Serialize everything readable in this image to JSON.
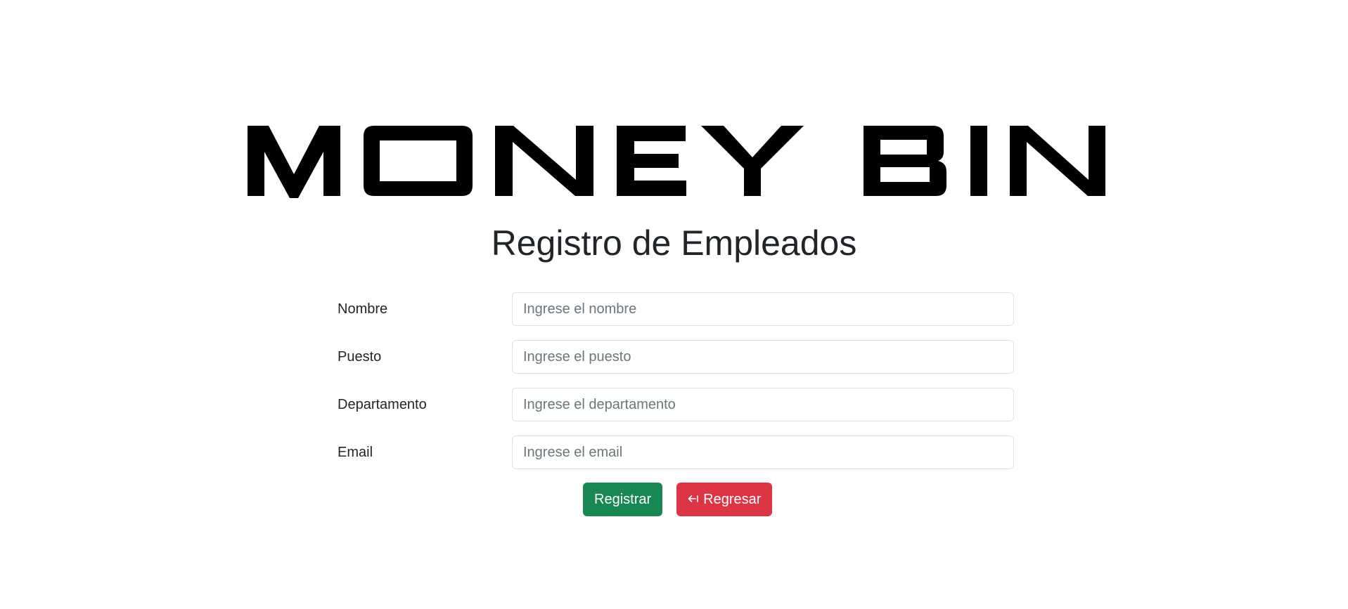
{
  "logo": {
    "text": "MONEY BIN"
  },
  "page": {
    "title": "Registro de Empleados"
  },
  "form": {
    "fields": [
      {
        "label": "Nombre",
        "placeholder": "Ingrese el nombre",
        "value": ""
      },
      {
        "label": "Puesto",
        "placeholder": "Ingrese el puesto",
        "value": ""
      },
      {
        "label": "Departamento",
        "placeholder": "Ingrese el departamento",
        "value": ""
      },
      {
        "label": "Email",
        "placeholder": "Ingrese el email",
        "value": ""
      }
    ]
  },
  "actions": {
    "register_label": "Registrar",
    "back_label": "Regresar",
    "back_icon": "arrow-left-to-bar-icon",
    "register_color": "#198754",
    "back_color": "#dc3545"
  }
}
